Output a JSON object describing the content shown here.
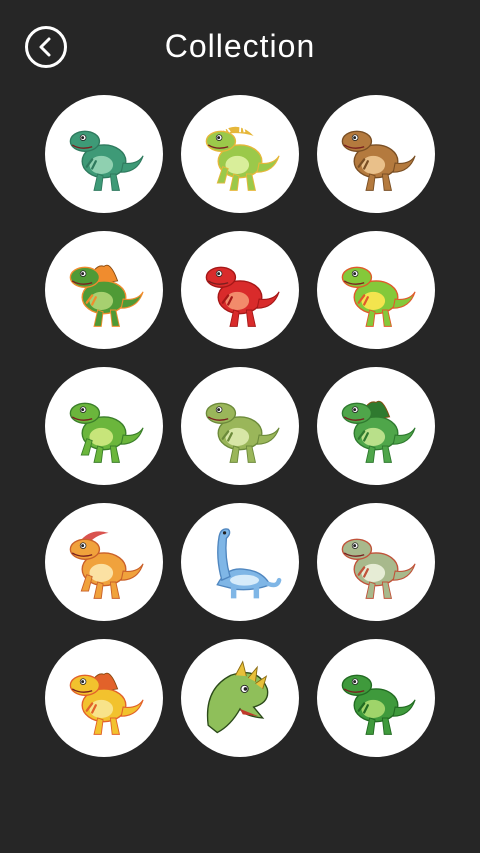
{
  "header": {
    "title": "Collection",
    "back_icon": "chevron-left-icon"
  },
  "collection": {
    "items": [
      {
        "name": "green-trex",
        "body": "#3e9a77",
        "belly": "#8fd0b0",
        "accent": "#2f7a5e",
        "pose": "biped"
      },
      {
        "name": "green-triceratops",
        "body": "#9bc94a",
        "belly": "#d9ee9a",
        "accent": "#e6b73a",
        "pose": "quad-horn"
      },
      {
        "name": "brown-raptor",
        "body": "#b47a3e",
        "belly": "#e9c08a",
        "accent": "#7a4f24",
        "pose": "biped"
      },
      {
        "name": "green-spinosaurus",
        "body": "#4f9a36",
        "belly": "#a7d070",
        "accent": "#f08c2e",
        "pose": "sail"
      },
      {
        "name": "red-trex",
        "body": "#d92b2b",
        "belly": "#f28b6b",
        "accent": "#a51717",
        "pose": "biped"
      },
      {
        "name": "yellow-green-raptor",
        "body": "#84c93a",
        "belly": "#f3e44e",
        "accent": "#e05a2b",
        "pose": "biped"
      },
      {
        "name": "green-family",
        "body": "#6bb63c",
        "belly": "#c7e57a",
        "accent": "#3b7f2a",
        "pose": "quad"
      },
      {
        "name": "olive-coelophysis",
        "body": "#9ab65a",
        "belly": "#d7e6a6",
        "accent": "#6c8a3a",
        "pose": "biped"
      },
      {
        "name": "green-parasaur",
        "body": "#4fa64a",
        "belly": "#b9e08a",
        "accent": "#2f7a2f",
        "pose": "sail"
      },
      {
        "name": "orange-parasaurolophus",
        "body": "#f0a23c",
        "belly": "#fbe1a3",
        "accent": "#c9602a",
        "pose": "quad-crest"
      },
      {
        "name": "blue-brachiosaurus",
        "body": "#7fb6e6",
        "belly": "#d6ebfa",
        "accent": "#4f86bf",
        "pose": "longneck"
      },
      {
        "name": "grey-trex",
        "body": "#a8b98c",
        "belly": "#e6ecd5",
        "accent": "#c0533a",
        "pose": "biped"
      },
      {
        "name": "yellow-spinosaurus",
        "body": "#f2c22e",
        "belly": "#f8e38a",
        "accent": "#e2622a",
        "pose": "sail"
      },
      {
        "name": "trex-head",
        "body": "#8fbf5a",
        "belly": "#e8f0c0",
        "accent": "#e7c03a",
        "pose": "head"
      },
      {
        "name": "cartoon-green-trex",
        "body": "#3f9a3c",
        "belly": "#9fd46a",
        "accent": "#226b22",
        "pose": "biped"
      }
    ]
  }
}
